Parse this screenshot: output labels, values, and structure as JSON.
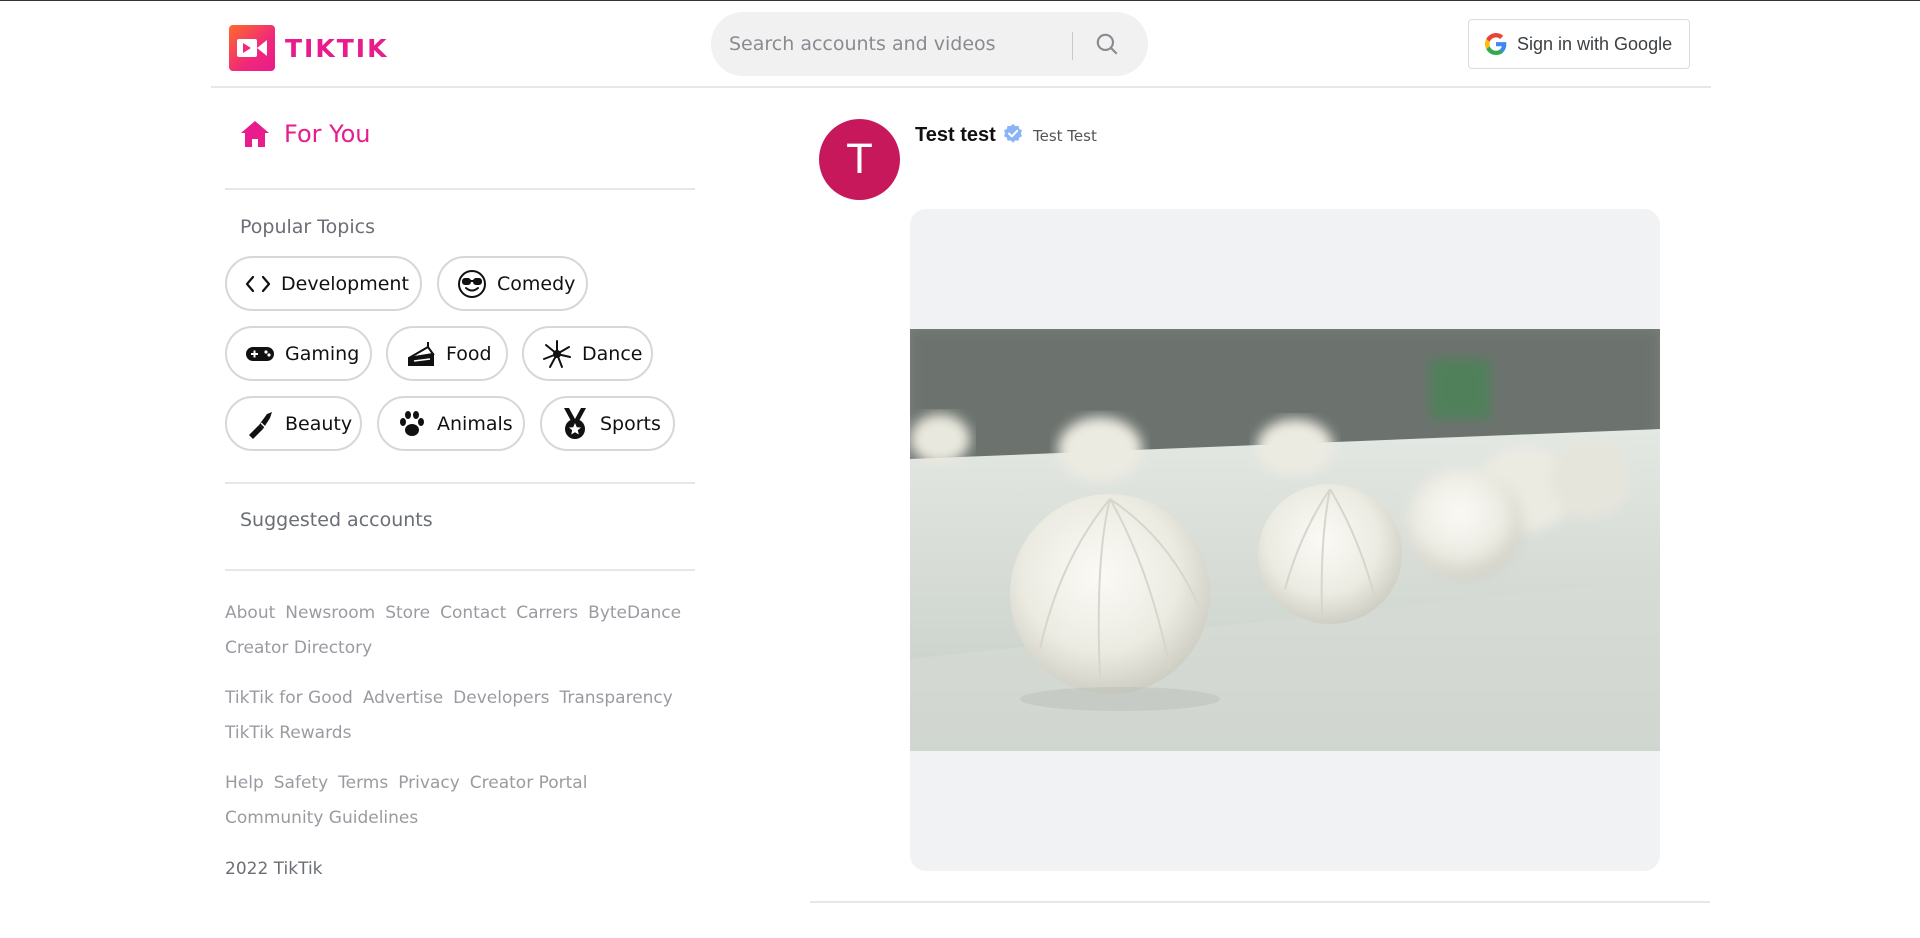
{
  "header": {
    "logo_text": "TIKTIK",
    "search_placeholder": "Search accounts and videos",
    "signin_label": "Sign in with Google"
  },
  "sidebar": {
    "for_you": "For You",
    "popular_topics_title": "Popular Topics",
    "topics": [
      {
        "label": "Development",
        "icon": "code-icon"
      },
      {
        "label": "Comedy",
        "icon": "sunglasses-face-icon"
      },
      {
        "label": "Gaming",
        "icon": "gamepad-icon"
      },
      {
        "label": "Food",
        "icon": "cake-icon"
      },
      {
        "label": "Dance",
        "icon": "firework-icon"
      },
      {
        "label": "Beauty",
        "icon": "lipstick-icon"
      },
      {
        "label": "Animals",
        "icon": "paw-icon"
      },
      {
        "label": "Sports",
        "icon": "medal-icon"
      }
    ],
    "suggested_title": "Suggested accounts",
    "footer_rows": [
      [
        "About",
        "Newsroom",
        "Store",
        "Contact",
        "Carrers",
        "ByteDance"
      ],
      [
        "Creator Directory"
      ],
      [
        "TikTik for Good",
        "Advertise",
        "Developers",
        "Transparency"
      ],
      [
        "TikTik Rewards"
      ],
      [
        "Help",
        "Safety",
        "Terms",
        "Privacy",
        "Creator Portal"
      ],
      [
        "Community Guidelines"
      ]
    ],
    "copyright": "2022 TikTik"
  },
  "post": {
    "avatar_letter": "T",
    "user_name": "Test test",
    "handle": "Test Test"
  },
  "colors": {
    "brand_pink": "#e81c8c",
    "avatar_bg": "#c6185a",
    "verified_blue": "#8ab4f8"
  }
}
